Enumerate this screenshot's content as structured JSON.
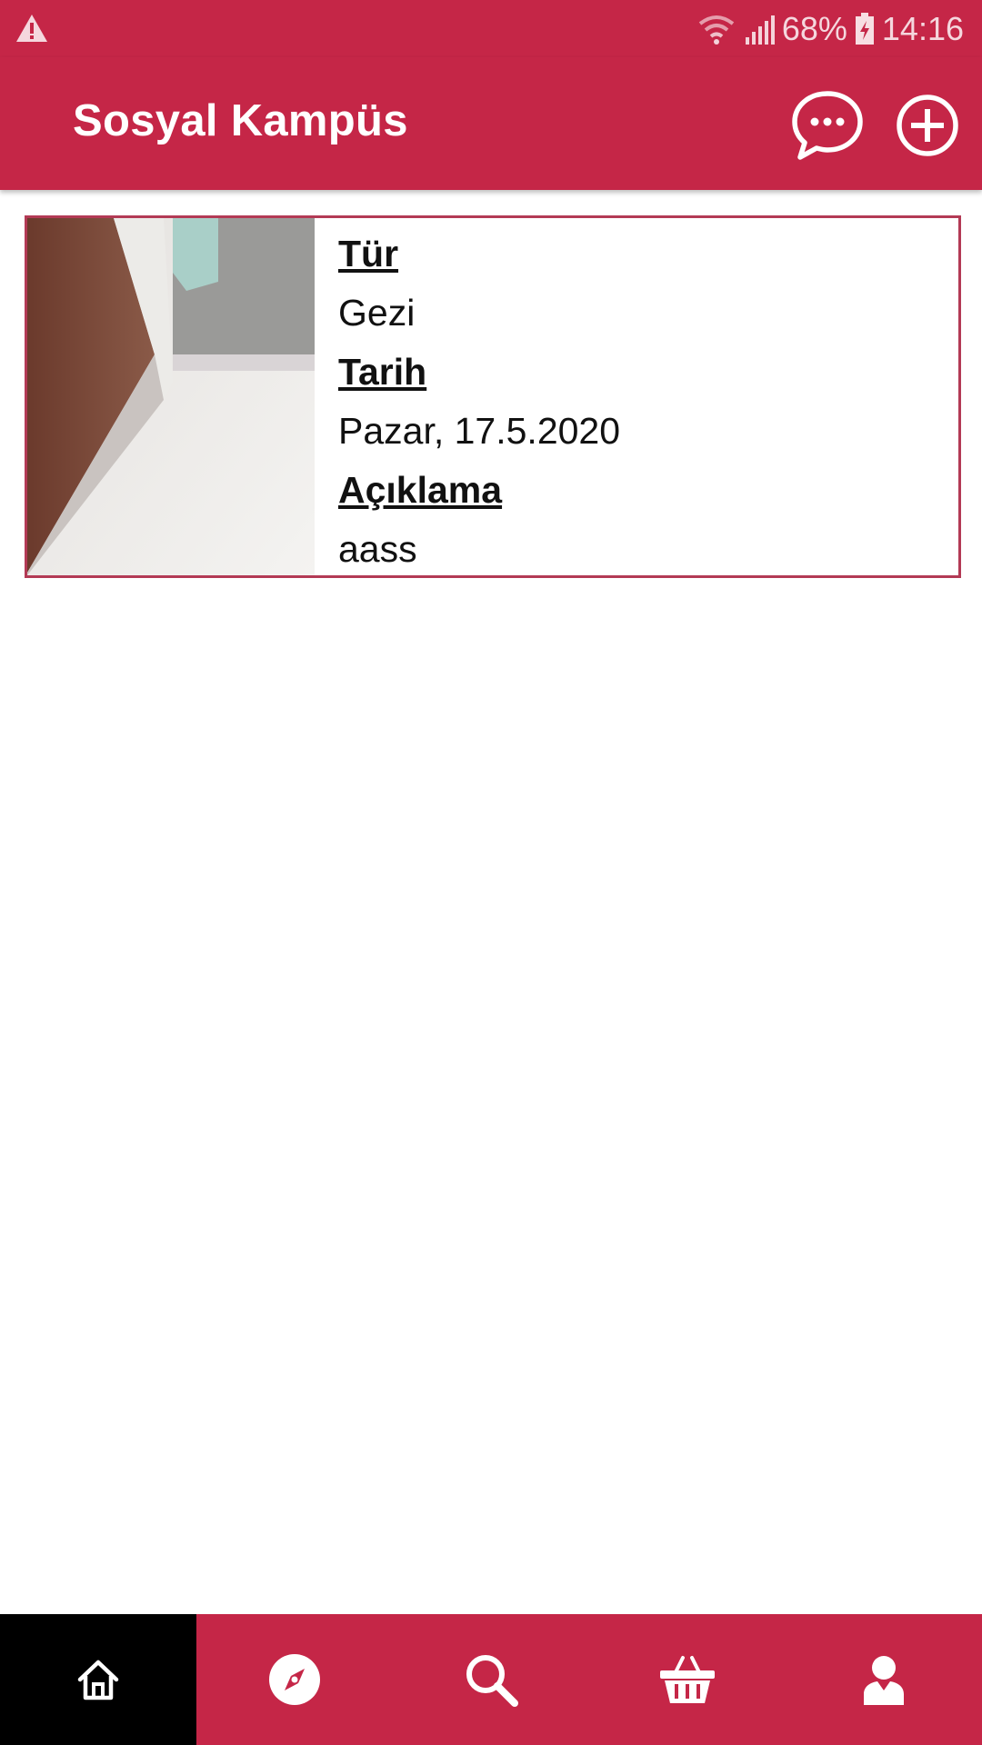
{
  "status_bar": {
    "battery": "68%",
    "time": "14:16",
    "icons": [
      "warning-icon",
      "wifi-icon",
      "signal-icon",
      "battery-charging-icon"
    ]
  },
  "app_bar": {
    "title": "Sosyal Kampüs",
    "actions": [
      {
        "name": "chat-icon"
      },
      {
        "name": "add-circle-icon"
      }
    ]
  },
  "post": {
    "type_label": "Tür",
    "type_value": "Gezi",
    "date_label": "Tarih",
    "date_value": "Pazar, 17.5.2020",
    "description_label": "Açıklama",
    "description_value": "aass"
  },
  "bottom_nav": {
    "items": [
      {
        "icon": "home-icon",
        "active": true
      },
      {
        "icon": "compass-icon",
        "active": false
      },
      {
        "icon": "search-icon",
        "active": false
      },
      {
        "icon": "basket-icon",
        "active": false
      },
      {
        "icon": "profile-icon",
        "active": false
      }
    ]
  },
  "colors": {
    "brand": "#c52647",
    "card_border": "#b33a55",
    "active_nav": "#000000"
  }
}
